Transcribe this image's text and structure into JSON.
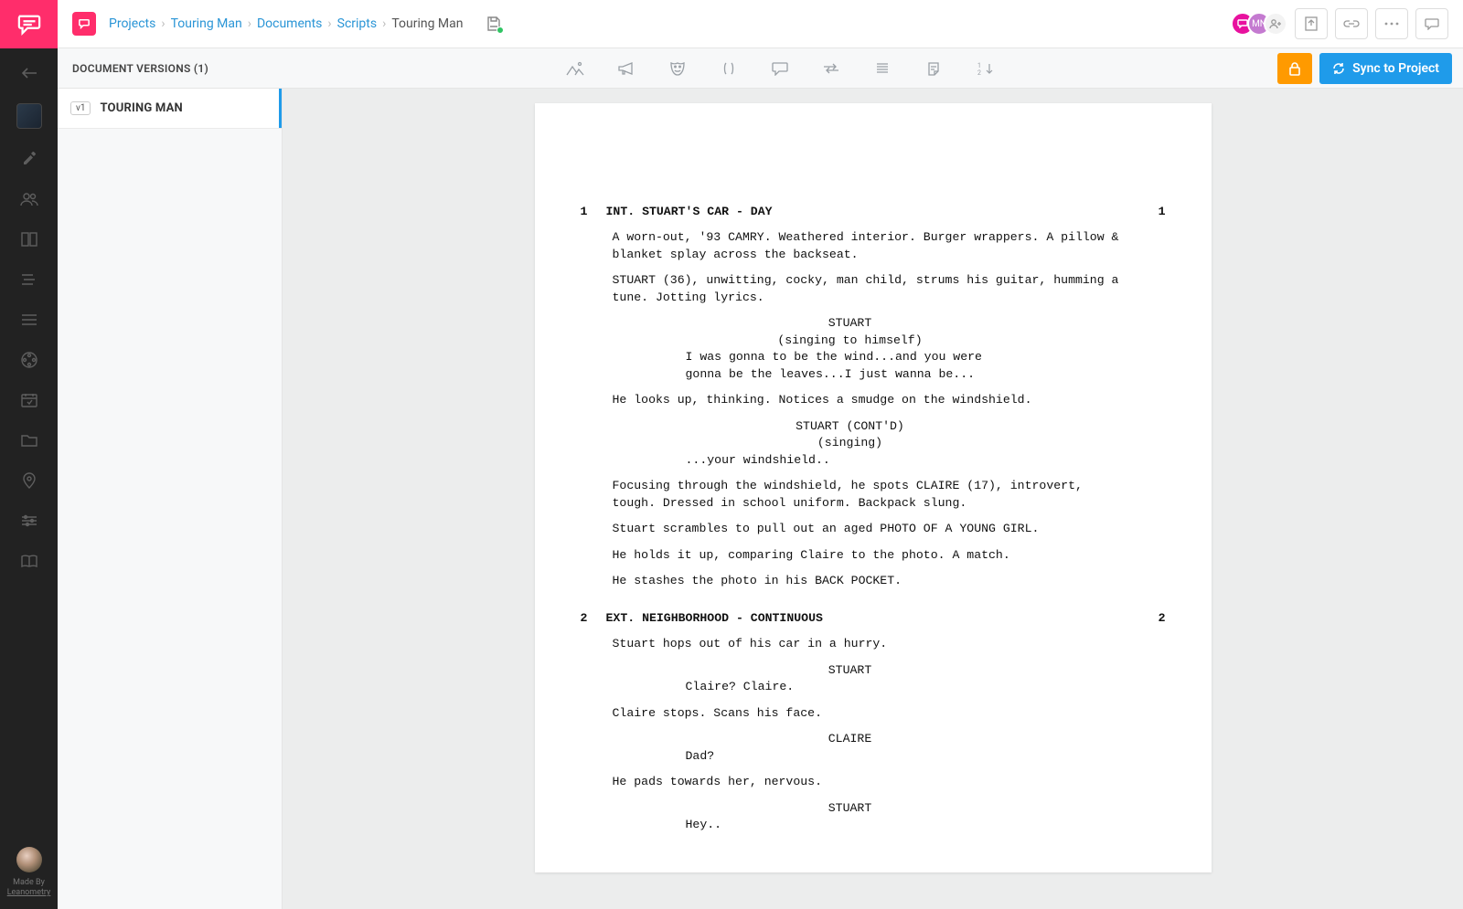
{
  "breadcrumbs": {
    "items": [
      "Projects",
      "Touring Man",
      "Documents",
      "Scripts",
      "Touring Man"
    ]
  },
  "presence": {
    "b_label": "MN"
  },
  "toolbar": {
    "versions_label": "DOCUMENT VERSIONS (1)",
    "sync_label": "Sync to Project"
  },
  "versions": [
    {
      "badge": "v1",
      "title": "TOURING MAN"
    }
  ],
  "footer": {
    "made_by": "Made By",
    "brand": "Leanometry"
  },
  "script": {
    "scenes": [
      {
        "num": "1",
        "heading": "INT. STUART'S CAR - DAY",
        "blocks": [
          {
            "t": "action",
            "text": "A worn-out, '93 CAMRY. Weathered interior. Burger wrappers. A pillow & blanket splay across the backseat."
          },
          {
            "t": "action",
            "text": "STUART (36), unwitting, cocky, man child, strums his guitar, humming a tune. Jotting lyrics."
          },
          {
            "t": "dialog",
            "char": "STUART",
            "paren": "(singing to himself)",
            "speech": "I was gonna to be the wind...and you were gonna be the leaves...I just wanna be..."
          },
          {
            "t": "action",
            "text": "He looks up, thinking. Notices a smudge on the windshield."
          },
          {
            "t": "dialog",
            "char": "STUART (CONT'D)",
            "paren": "(singing)",
            "speech": "...your windshield.."
          },
          {
            "t": "action",
            "text": "Focusing through the windshield, he spots CLAIRE (17), introvert, tough. Dressed in school uniform. Backpack slung."
          },
          {
            "t": "action",
            "text": "Stuart scrambles to pull out an aged PHOTO OF A YOUNG GIRL."
          },
          {
            "t": "action",
            "text": "He holds it up, comparing Claire to the photo. A match."
          },
          {
            "t": "action",
            "text": "He stashes the photo in his BACK POCKET."
          }
        ]
      },
      {
        "num": "2",
        "heading": "EXT. NEIGHBORHOOD - CONTINUOUS",
        "blocks": [
          {
            "t": "action",
            "text": "Stuart hops out of his car in a hurry."
          },
          {
            "t": "dialog",
            "char": "STUART",
            "speech": "Claire? Claire."
          },
          {
            "t": "action",
            "text": "Claire stops. Scans his face."
          },
          {
            "t": "dialog",
            "char": "CLAIRE",
            "speech": "Dad?"
          },
          {
            "t": "action",
            "text": "He pads towards her, nervous."
          },
          {
            "t": "dialog",
            "char": "STUART",
            "speech": "Hey.."
          }
        ]
      }
    ]
  }
}
